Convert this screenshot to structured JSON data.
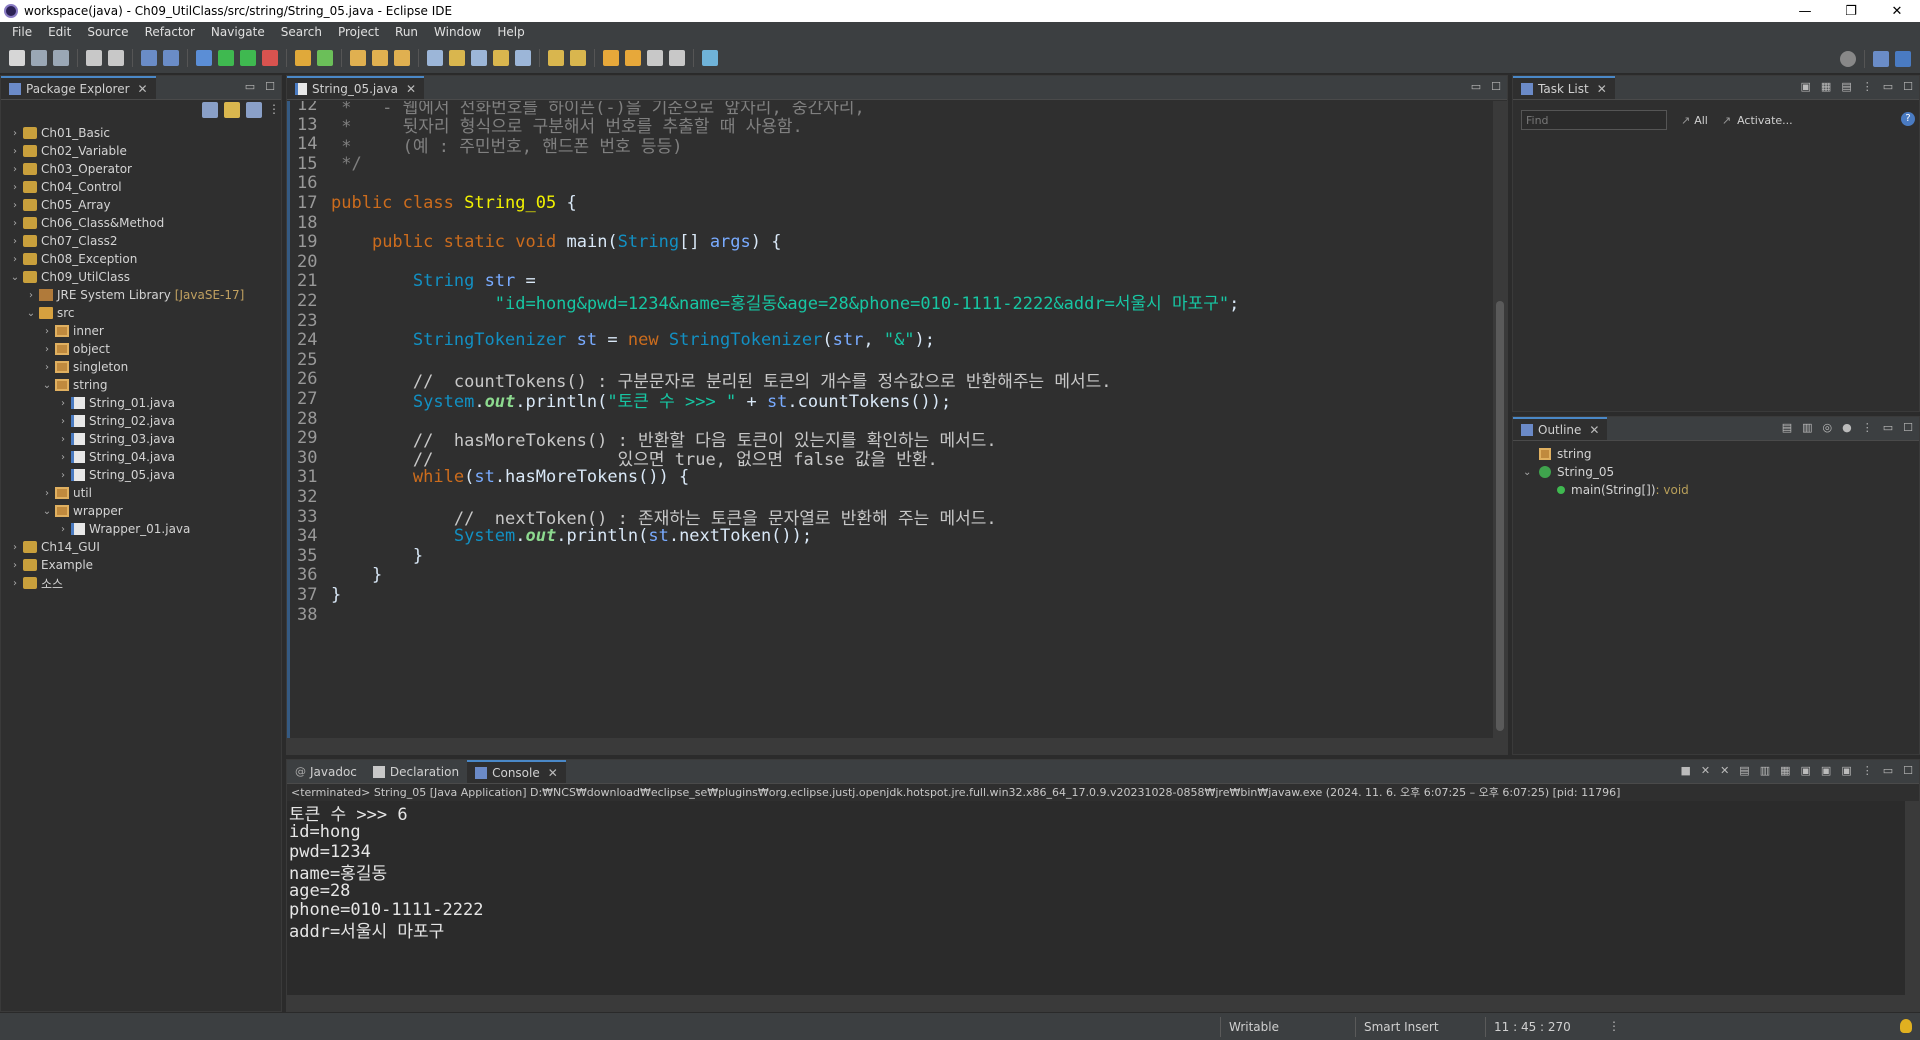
{
  "window": {
    "title": "workspace(java) - Ch09_UtilClass/src/string/String_05.java - Eclipse IDE",
    "minimize": "—",
    "maximize": "❐",
    "close": "✕"
  },
  "menu": [
    "File",
    "Edit",
    "Source",
    "Refactor",
    "Navigate",
    "Search",
    "Project",
    "Run",
    "Window",
    "Help"
  ],
  "package_explorer": {
    "tab_label": "Package Explorer",
    "items": [
      {
        "label": "Ch01_Basic",
        "depth": 0,
        "arrow": "›",
        "icon": "project"
      },
      {
        "label": "Ch02_Variable",
        "depth": 0,
        "arrow": "›",
        "icon": "project"
      },
      {
        "label": "Ch03_Operator",
        "depth": 0,
        "arrow": "›",
        "icon": "project"
      },
      {
        "label": "Ch04_Control",
        "depth": 0,
        "arrow": "›",
        "icon": "project"
      },
      {
        "label": "Ch05_Array",
        "depth": 0,
        "arrow": "›",
        "icon": "project"
      },
      {
        "label": "Ch06_Class&Method",
        "depth": 0,
        "arrow": "›",
        "icon": "project"
      },
      {
        "label": "Ch07_Class2",
        "depth": 0,
        "arrow": "›",
        "icon": "project"
      },
      {
        "label": "Ch08_Exception",
        "depth": 0,
        "arrow": "›",
        "icon": "project"
      },
      {
        "label": "Ch09_UtilClass",
        "depth": 0,
        "arrow": "⌄",
        "icon": "project"
      },
      {
        "label": "JRE System Library",
        "decor": "[JavaSE-17]",
        "depth": 1,
        "arrow": "›",
        "icon": "lib"
      },
      {
        "label": "src",
        "depth": 1,
        "arrow": "⌄",
        "icon": "src"
      },
      {
        "label": "inner",
        "depth": 2,
        "arrow": "›",
        "icon": "pkg"
      },
      {
        "label": "object",
        "depth": 2,
        "arrow": "›",
        "icon": "pkg"
      },
      {
        "label": "singleton",
        "depth": 2,
        "arrow": "›",
        "icon": "pkg"
      },
      {
        "label": "string",
        "depth": 2,
        "arrow": "⌄",
        "icon": "pkg"
      },
      {
        "label": "String_01.java",
        "depth": 3,
        "arrow": "›",
        "icon": "java"
      },
      {
        "label": "String_02.java",
        "depth": 3,
        "arrow": "›",
        "icon": "java"
      },
      {
        "label": "String_03.java",
        "depth": 3,
        "arrow": "›",
        "icon": "java"
      },
      {
        "label": "String_04.java",
        "depth": 3,
        "arrow": "›",
        "icon": "java"
      },
      {
        "label": "String_05.java",
        "depth": 3,
        "arrow": "›",
        "icon": "java"
      },
      {
        "label": "util",
        "depth": 2,
        "arrow": "›",
        "icon": "pkg"
      },
      {
        "label": "wrapper",
        "depth": 2,
        "arrow": "⌄",
        "icon": "pkg"
      },
      {
        "label": "Wrapper_01.java",
        "depth": 3,
        "arrow": "›",
        "icon": "java"
      },
      {
        "label": "Ch14_GUI",
        "depth": 0,
        "arrow": "›",
        "icon": "project"
      },
      {
        "label": "Example",
        "depth": 0,
        "arrow": "›",
        "icon": "project"
      },
      {
        "label": "소스",
        "depth": 0,
        "arrow": "›",
        "icon": "project"
      }
    ]
  },
  "editor": {
    "tab_label": "String_05.java",
    "lines": [
      {
        "n": "12",
        "t": " *   - 웹에서 전화번호를 하이픈(-)을 기준으로 앞자리, 중간자리,"
      },
      {
        "n": "13",
        "t": " *     뒷자리 형식으로 구분해서 번호를 추출할 때 사용함."
      },
      {
        "n": "14",
        "t": " *     (예 : 주민번호, 핸드폰 번호 등등)"
      },
      {
        "n": "15",
        "t": " */"
      },
      {
        "n": "16",
        "t": ""
      },
      {
        "n": "17",
        "t": "public class String_05 {"
      },
      {
        "n": "18",
        "t": ""
      },
      {
        "n": "19",
        "t": "    public static void main(String[] args) {"
      },
      {
        "n": "20",
        "t": ""
      },
      {
        "n": "21",
        "t": "        String str ="
      },
      {
        "n": "22",
        "t": "                \"id=hong&pwd=1234&name=홍길동&age=28&phone=010-1111-2222&addr=서울시 마포구\";"
      },
      {
        "n": "23",
        "t": ""
      },
      {
        "n": "24",
        "t": "        StringTokenizer st = new StringTokenizer(str, \"&\");"
      },
      {
        "n": "25",
        "t": ""
      },
      {
        "n": "26",
        "t": "        //  countTokens() : 구분문자로 분리된 토큰의 개수를 정수값으로 반환해주는 메서드."
      },
      {
        "n": "27",
        "t": "        System.out.println(\"토큰 수 >>> \" + st.countTokens());"
      },
      {
        "n": "28",
        "t": ""
      },
      {
        "n": "29",
        "t": "        //  hasMoreTokens() : 반환할 다음 토큰이 있는지를 확인하는 메서드."
      },
      {
        "n": "30",
        "t": "        //                  있으면 true, 없으면 false 값을 반환."
      },
      {
        "n": "31",
        "t": "        while(st.hasMoreTokens()) {"
      },
      {
        "n": "32",
        "t": ""
      },
      {
        "n": "33",
        "t": "            //  nextToken() : 존재하는 토큰을 문자열로 반환해 주는 메서드."
      },
      {
        "n": "34",
        "t": "            System.out.println(st.nextToken());"
      },
      {
        "n": "35",
        "t": "        }"
      },
      {
        "n": "36",
        "t": "    }"
      },
      {
        "n": "37",
        "t": "}"
      },
      {
        "n": "38",
        "t": ""
      }
    ]
  },
  "task_list": {
    "tab_label": "Task List",
    "find_placeholder": "Find",
    "all_label": "All",
    "activate_label": "Activate..."
  },
  "outline": {
    "tab_label": "Outline",
    "items": [
      {
        "label": "string",
        "depth": 0
      },
      {
        "label": "String_05",
        "depth": 0
      },
      {
        "label": "main(String[])",
        "ret": " : void",
        "depth": 1
      }
    ]
  },
  "console": {
    "tabs": [
      "Javadoc",
      "Declaration",
      "Console"
    ],
    "header": "<terminated> String_05 [Java Application] D:₩NCS₩download₩eclipse_se₩plugins₩org.eclipse.justj.openjdk.hotspot.jre.full.win32.x86_64_17.0.9.v20231028-0858₩jre₩bin₩javaw.exe  (2024. 11. 6. 오후 6:07:25 – 오후 6:07:25) [pid: 11796]",
    "lines": [
      "토큰 수 >>> 6",
      "id=hong",
      "pwd=1234",
      "name=홍길동",
      "age=28",
      "phone=010-1111-2222",
      "addr=서울시 마포구"
    ]
  },
  "status": {
    "writable": "Writable",
    "insert": "Smart Insert",
    "position": "11 : 45 : 270"
  }
}
